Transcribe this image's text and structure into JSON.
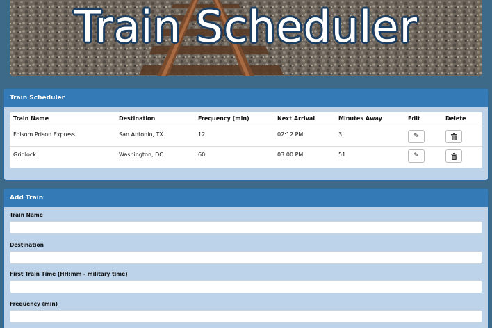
{
  "banner": {
    "title": "Train Scheduler"
  },
  "schedule_panel": {
    "heading": "Train Scheduler",
    "columns": [
      "Train Name",
      "Destination",
      "Frequency (min)",
      "Next Arrival",
      "Minutes Away",
      "Edit",
      "Delete"
    ],
    "rows": [
      {
        "name": "Folsom Prison Express",
        "destination": "San Antonio, TX",
        "frequency": "12",
        "next_arrival": "02:12 PM",
        "minutes_away": "3"
      },
      {
        "name": "Gridlock",
        "destination": "Washington, DC",
        "frequency": "60",
        "next_arrival": "03:00 PM",
        "minutes_away": "51"
      }
    ],
    "edit_icon": "pencil-icon",
    "delete_icon": "trash-icon"
  },
  "add_panel": {
    "heading": "Add Train",
    "fields": [
      {
        "label": "Train Name",
        "value": ""
      },
      {
        "label": "Destination",
        "value": ""
      },
      {
        "label": "First Train Time (HH:mm - military time)",
        "value": ""
      },
      {
        "label": "Frequency (min)",
        "value": ""
      }
    ]
  },
  "colors": {
    "page_bg": "#3e6a8a",
    "panel_header": "#337ab7",
    "panel_body": "#bcd3e9",
    "title_outline": "#1c3f63"
  }
}
